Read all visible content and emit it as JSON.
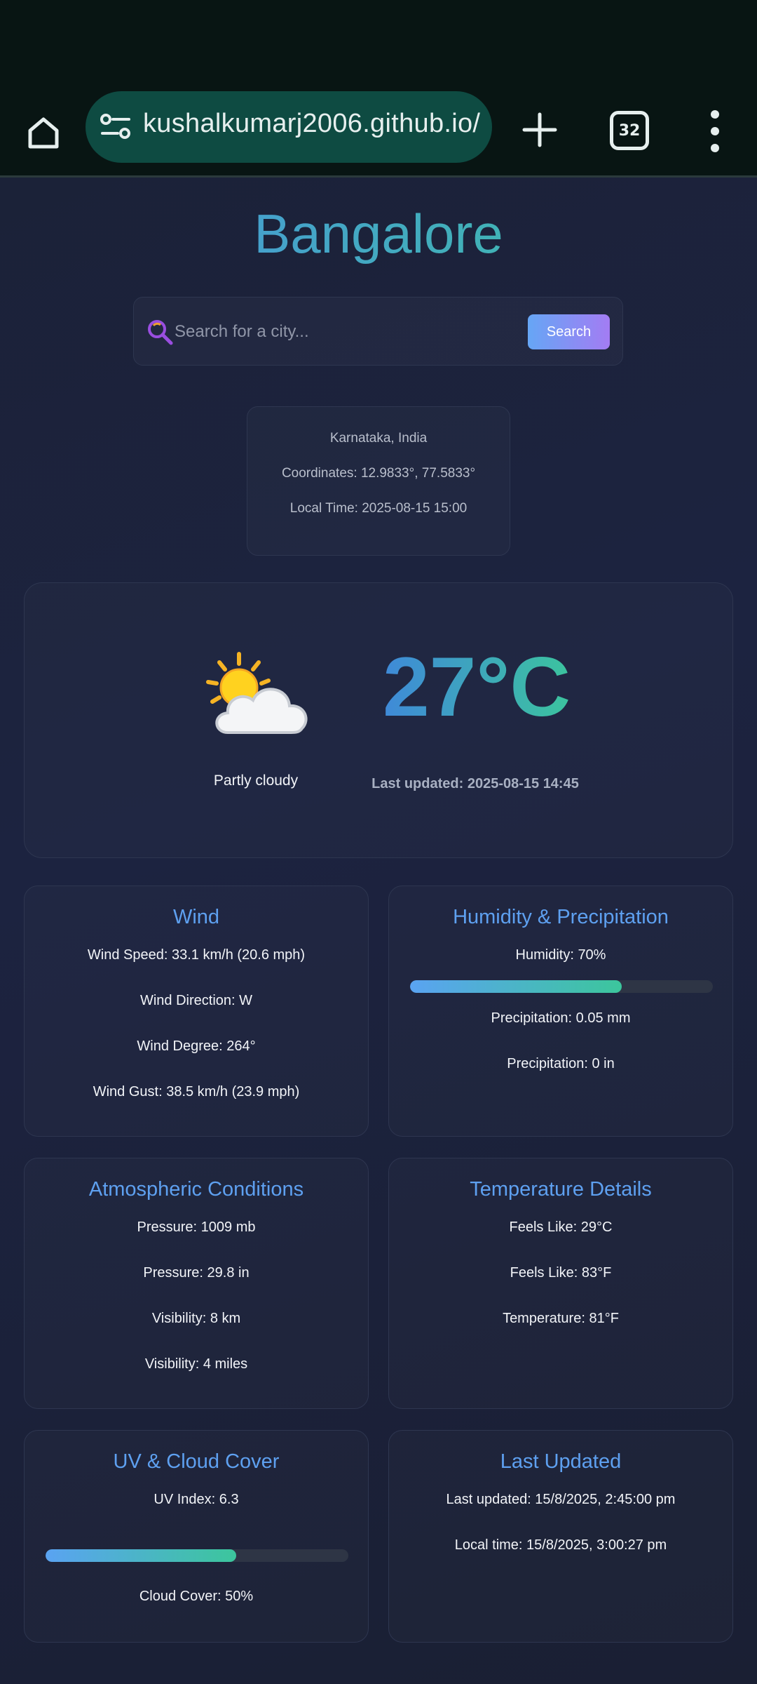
{
  "browser": {
    "url": "kushalkumarj2006.github.io/",
    "tab_count": "32"
  },
  "header": {
    "city": "Bangalore"
  },
  "search": {
    "placeholder": "Search for a city...",
    "button_label": "Search"
  },
  "location": {
    "region": "Karnataka, India",
    "coordinates": "Coordinates: 12.9833°, 77.5833°",
    "local_time": "Local Time: 2025-08-15 15:00"
  },
  "current": {
    "icon": "partly-cloudy-icon",
    "condition": "Partly cloudy",
    "temperature": "27°C",
    "last_updated": "Last updated: 2025-08-15 14:45"
  },
  "cards": {
    "wind": {
      "title": "Wind",
      "speed": "Wind Speed: 33.1 km/h (20.6 mph)",
      "direction": "Wind Direction: W",
      "degree": "Wind Degree: 264°",
      "gust": "Wind Gust: 38.5 km/h (23.9 mph)"
    },
    "humidity": {
      "title": "Humidity & Precipitation",
      "humidity": "Humidity: 70%",
      "humidity_fraction": 0.7,
      "precip_mm": "Precipitation: 0.05 mm",
      "precip_in": "Precipitation: 0 in"
    },
    "atmosphere": {
      "title": "Atmospheric Conditions",
      "pressure_mb": "Pressure: 1009 mb",
      "pressure_in": "Pressure: 29.8 in",
      "visibility_km": "Visibility: 8 km",
      "visibility_miles": "Visibility: 4 miles"
    },
    "temperature": {
      "title": "Temperature Details",
      "feels_c": "Feels Like: 29°C",
      "feels_f": "Feels Like: 83°F",
      "temp_f": "Temperature: 81°F"
    },
    "uv": {
      "title": "UV & Cloud Cover",
      "uv_index": "UV Index: 6.3",
      "uv_fraction": 0.63,
      "cloud_cover": "Cloud Cover: 50%"
    },
    "updated": {
      "title": "Last Updated",
      "last_updated": "Last updated: 15/8/2025, 2:45:00 pm",
      "local_time": "Local time: 15/8/2025, 3:00:27 pm"
    }
  },
  "colors": {
    "accent_blue": "#5ea0f0",
    "accent_green": "#3cc69c",
    "button_gradient_end": "#a37cf3"
  }
}
